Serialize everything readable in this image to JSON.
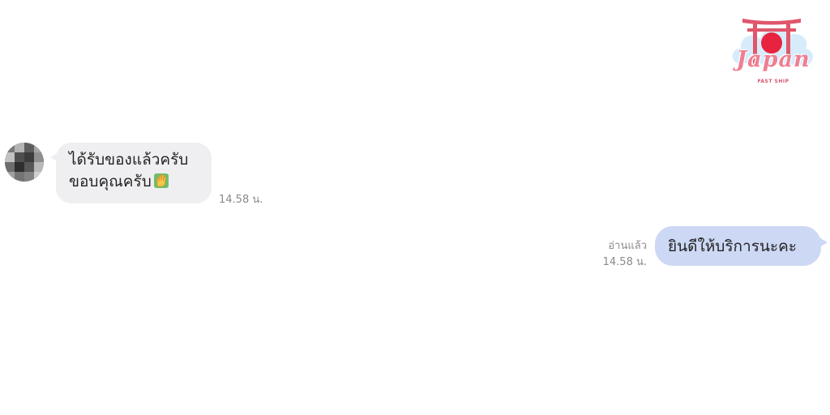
{
  "brand": {
    "logo_text": "Japan",
    "logo_subtext": "FAST SHIP",
    "accent": "#ef7f92",
    "torii_color": "#e0566a",
    "sun_color": "#e8233f",
    "cloud_color": "#d7ecfa"
  },
  "chat": {
    "incoming": {
      "avatar_icon": "user-avatar-icon",
      "lines": [
        "ได้รับของแล้วครับ",
        "ขอบคุณครับ"
      ],
      "emoji_icon": "raised-hand-emoji-icon",
      "time": "14.58 น.",
      "bubble_color": "#efeff1"
    },
    "outgoing": {
      "text": "ยินดีให้บริการนะคะ",
      "read_status": "อ่านแล้ว",
      "time": "14.58 น.",
      "bubble_color": "#cdd8f5"
    }
  }
}
